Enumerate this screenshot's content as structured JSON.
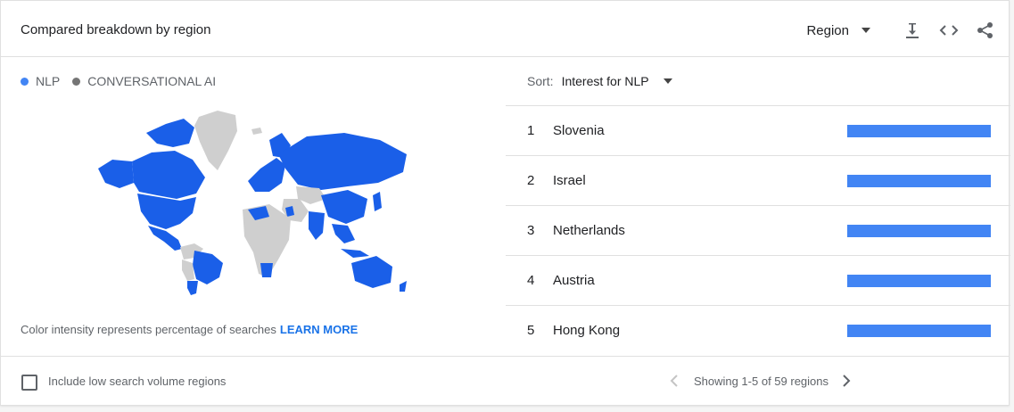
{
  "header": {
    "title": "Compared breakdown by region",
    "region_dropdown": "Region",
    "icons": [
      "download-icon",
      "embed-code-icon",
      "share-icon"
    ]
  },
  "legend": [
    {
      "label": "NLP",
      "color": "#4285f4"
    },
    {
      "label": "CONVERSATIONAL AI",
      "color": "#757575"
    }
  ],
  "map": {
    "highlight_color": "#1a5fe8",
    "base_color": "#cfcfcf"
  },
  "note": {
    "text": "Color intensity represents percentage of searches",
    "link": "LEARN MORE"
  },
  "sort": {
    "label": "Sort:",
    "value": "Interest for NLP"
  },
  "regions": [
    {
      "rank": "1",
      "name": "Slovenia",
      "value": 100
    },
    {
      "rank": "2",
      "name": "Israel",
      "value": 100
    },
    {
      "rank": "3",
      "name": "Netherlands",
      "value": 100
    },
    {
      "rank": "4",
      "name": "Austria",
      "value": 100
    },
    {
      "rank": "5",
      "name": "Hong Kong",
      "value": 100
    }
  ],
  "footer": {
    "checkbox_label": "Include low search volume regions",
    "pagination": "Showing 1-5 of 59 regions"
  }
}
